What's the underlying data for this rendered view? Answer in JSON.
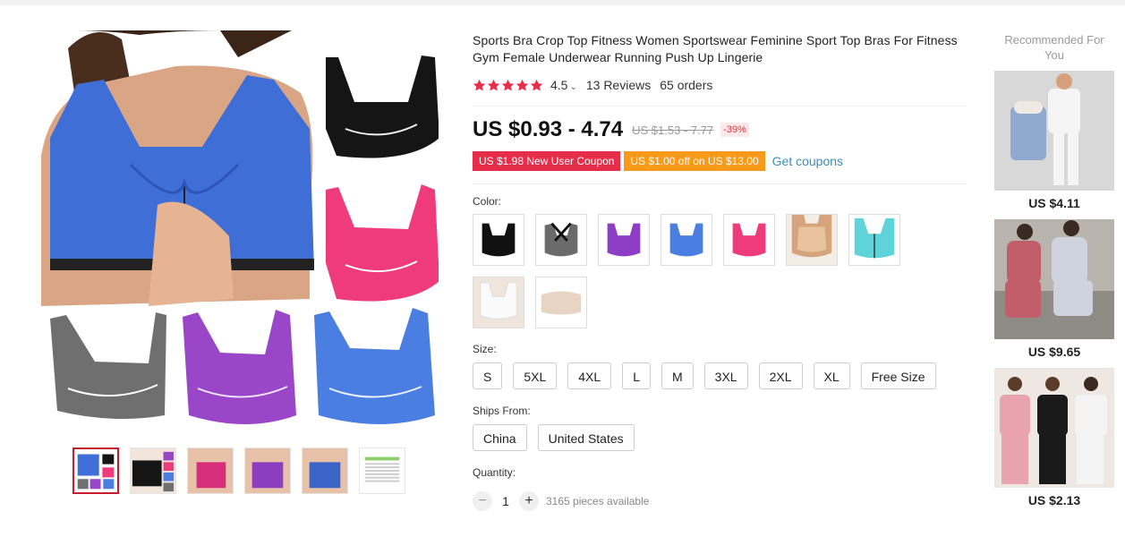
{
  "product": {
    "title": "Sports Bra Crop Top Fitness Women Sportswear Feminine Sport Top Bras For Fitness Gym Female Underwear Running Push Up Lingerie",
    "rating": "4.5",
    "reviews": "13 Reviews",
    "orders": "65 orders",
    "price": "US $0.93 - 4.74",
    "original_price": "US $1.53 - 7.77",
    "discount": "-39%",
    "coupons": [
      "US $1.98 New User Coupon",
      "US $1.00 off on US $13.00"
    ],
    "get_coupons": "Get coupons"
  },
  "color": {
    "label": "Color:",
    "swatches": [
      "black",
      "grey-black",
      "purple",
      "blue",
      "pink",
      "beige",
      "aqua",
      "white",
      "nude-bandeau"
    ]
  },
  "size": {
    "label": "Size:",
    "options": [
      "S",
      "5XL",
      "4XL",
      "L",
      "M",
      "3XL",
      "2XL",
      "XL",
      "Free Size"
    ]
  },
  "ships": {
    "label": "Ships From:",
    "options": [
      "China",
      "United States"
    ]
  },
  "quantity": {
    "label": "Quantity:",
    "minus": "−",
    "value": "1",
    "plus": "+",
    "available": "3165 pieces available"
  },
  "recommended": {
    "title": "Recommended For You",
    "items": [
      {
        "price": "US $4.11"
      },
      {
        "price": "US $9.65"
      },
      {
        "price": "US $2.13"
      }
    ]
  },
  "colors": {
    "accent_red": "#e62e4b",
    "accent_orange": "#f99a1a",
    "star": "#e62e4b",
    "link": "#3a8fb7"
  }
}
